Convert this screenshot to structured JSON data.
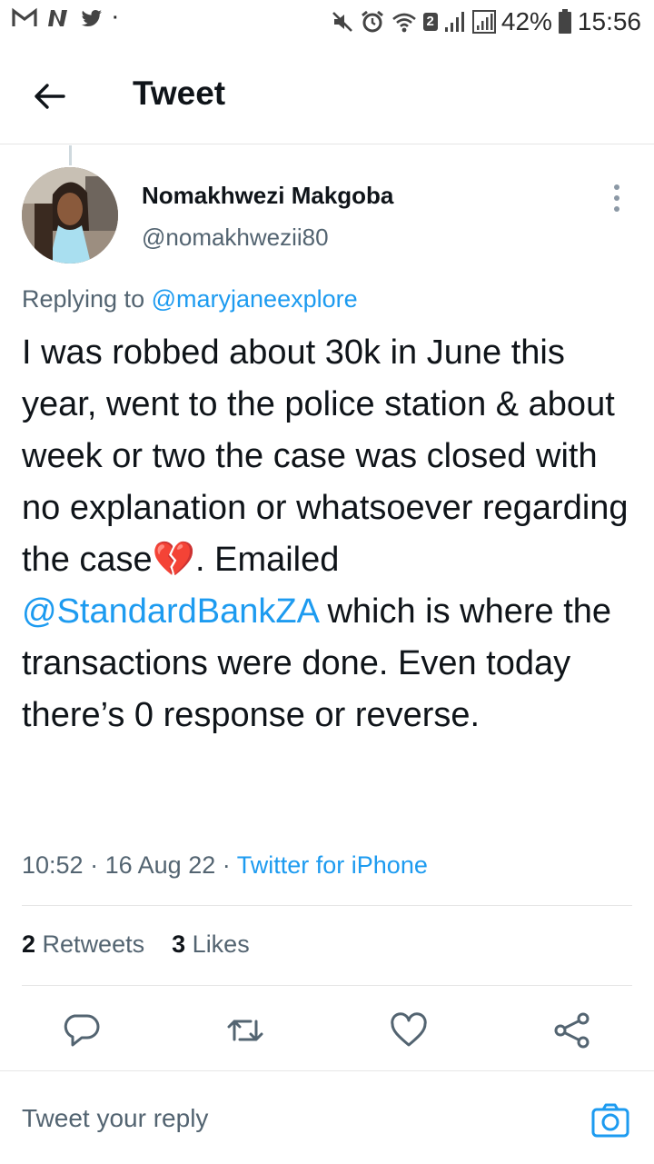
{
  "status_bar": {
    "notification_icons": [
      "gmail-icon",
      "news-icon",
      "twitter-icon"
    ],
    "sim_badge": "2",
    "battery": "42%",
    "time": "15:56"
  },
  "header": {
    "title": "Tweet"
  },
  "tweet": {
    "author_name": "Nomakhwezi Makgoba",
    "author_handle": "@nomakhwezii80",
    "replying_prefix": "Replying to",
    "replying_to": "@maryjaneexplore",
    "text_part1": "I was robbed about 30k in June this year, went to the police station & about week or two the case was closed with no explanation or whatsoever regarding the case",
    "emoji": "💔",
    "text_part2": ". Emailed",
    "mention": "@StandardBankZA",
    "text_part3": "which is where the transactions were done. Even today there’s 0 response or reverse.",
    "time": "10:52",
    "date": "16 Aug 22",
    "source": "Twitter for iPhone",
    "meta_sep": "·",
    "retweets_count": "2",
    "retweets_label": "Retweets",
    "likes_count": "3",
    "likes_label": "Likes"
  },
  "reply_bar": {
    "placeholder": "Tweet your reply"
  },
  "colors": {
    "accent": "#1d9bf0",
    "secondary_text": "#536471"
  }
}
